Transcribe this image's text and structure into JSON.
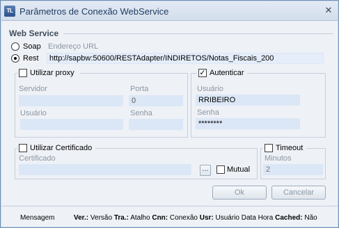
{
  "window": {
    "title": "Parâmetros de Conexão WebService",
    "app_icon": "TL",
    "close_glyph": "✕"
  },
  "web_service": {
    "section_label": "Web Service",
    "soap_label": "Soap",
    "rest_label": "Rest",
    "selected_protocol": "Rest",
    "url_label": "Endereço URL",
    "url_value": "http://sapbw:50600/RESTAdapter/INDIRETOS/Notas_Fiscais_200"
  },
  "proxy": {
    "checkbox_label": "Utilizar proxy",
    "checked": false,
    "server_label": "Servidor",
    "server_value": "",
    "port_label": "Porta",
    "port_value": "0",
    "user_label": "Usuário",
    "user_value": "",
    "password_label": "Senha",
    "password_value": ""
  },
  "auth": {
    "checkbox_label": "Autenticar",
    "checked": true,
    "check_glyph": "✓",
    "user_label": "Usuário",
    "user_value": "RRIBEIRO",
    "password_label": "Senha",
    "password_value": "********"
  },
  "certificate": {
    "checkbox_label": "Utilizar Certificado",
    "checked": false,
    "field_label": "Certificado",
    "field_value": "",
    "browse_label": "...",
    "mutual_label": "Mutual",
    "mutual_checked": false
  },
  "timeout": {
    "checkbox_label": "Timeout",
    "checked": false,
    "minutes_label": "Minutos",
    "minutes_value": "2"
  },
  "buttons": {
    "ok": "Ok",
    "cancel": "Cancelar"
  },
  "statusbar": {
    "message": "Mensagem",
    "ver_key": "Ver.:",
    "ver_value": "Versão",
    "tra_key": "Tra.:",
    "tra_value": "Atalho",
    "cnn_key": "Cnn:",
    "cnn_value": "Conexão",
    "usr_key": "Usr:",
    "usr_value": "Usuário Data Hora",
    "cached_key": "Cached:",
    "cached_value": "Não"
  }
}
